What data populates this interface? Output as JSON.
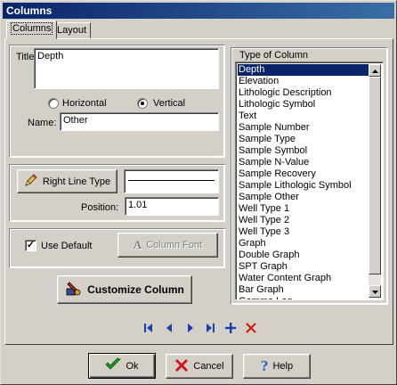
{
  "window": {
    "title": "Columns"
  },
  "tabs": [
    {
      "label": "Columns",
      "active": true
    },
    {
      "label": "Layout",
      "active": false
    }
  ],
  "title_field": {
    "label": "Title:",
    "value": "Depth"
  },
  "orientation": {
    "options": [
      "Horizontal",
      "Vertical"
    ],
    "selected": "Vertical"
  },
  "name_field": {
    "label": "Name:",
    "value": "Other"
  },
  "line": {
    "right_line_type_label": "Right Line Type",
    "position_label": "Position:",
    "position_value": "1.01"
  },
  "column_font": {
    "use_default_label": "Use Default",
    "use_default_checked": true,
    "column_font_label": "Column Font",
    "column_font_enabled": false
  },
  "customize_label": "Customize Column",
  "type_list": {
    "label": "Type of Column",
    "items": [
      "Depth",
      "Elevation",
      "Lithologic Description",
      "Lithologic Symbol",
      "Text",
      "Sample Number",
      "Sample Type",
      "Sample Symbol",
      "Sample N-Value",
      "Sample Recovery",
      "Sample Lithologic Symbol",
      "Sample Other",
      "Well Type 1",
      "Well Type 2",
      "Well Type 3",
      "Graph",
      "Double Graph",
      "SPT Graph",
      "Water Content Graph",
      "Bar Graph",
      "Gamma Log"
    ],
    "selected_index": 0
  },
  "nav": {
    "first_icon": "first-record-icon",
    "prev_icon": "previous-record-icon",
    "next_icon": "next-record-icon",
    "last_icon": "last-record-icon",
    "add_icon": "add-icon",
    "delete_icon": "delete-icon"
  },
  "buttons": {
    "ok": "Ok",
    "cancel": "Cancel",
    "help": "Help"
  },
  "colors": {
    "title_bar": "#0a246a",
    "selection": "#0a246a",
    "nav_blue": "#1a3fb0",
    "ok_green": "#1c9a1c",
    "cancel_red": "#d01818",
    "help_blue": "#1e60c8"
  }
}
